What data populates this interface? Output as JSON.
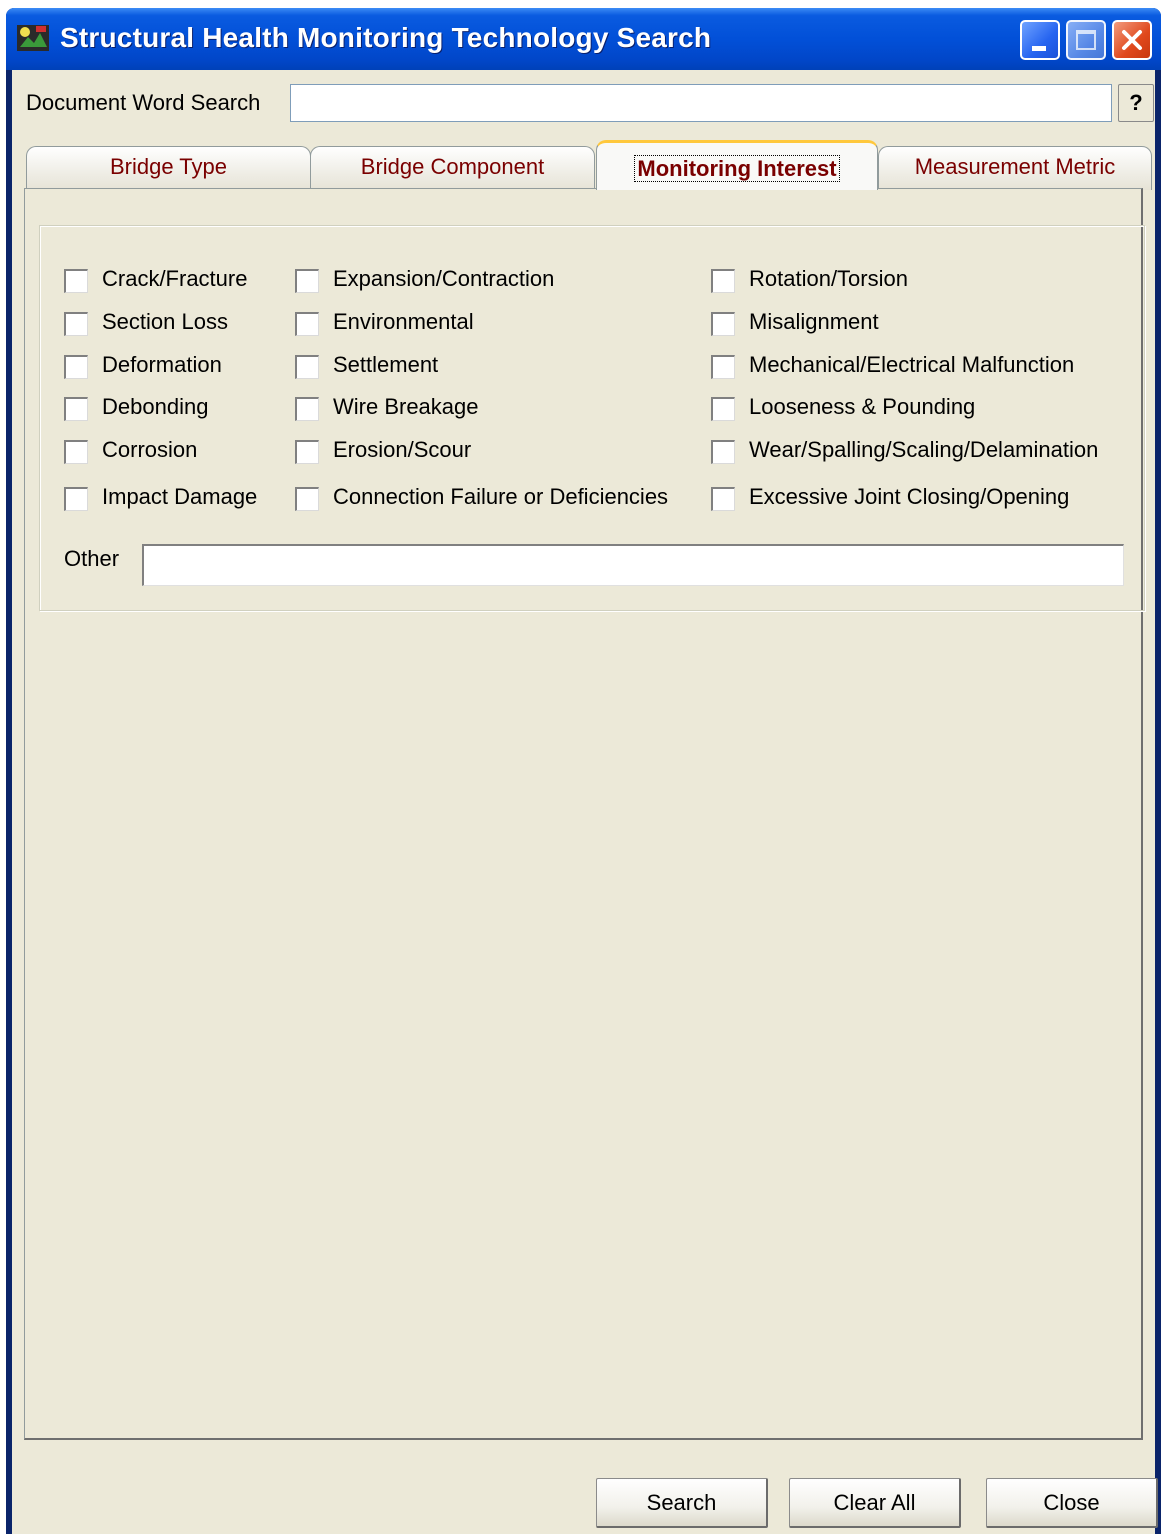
{
  "window": {
    "title": "Structural Health Monitoring Technology Search",
    "icon": "app-icon"
  },
  "search": {
    "label": "Document Word Search",
    "value": "",
    "help_label": "?"
  },
  "tabs": [
    {
      "label": "Bridge Type",
      "active": false
    },
    {
      "label": "Bridge Component",
      "active": false
    },
    {
      "label": "Monitoring Interest",
      "active": true
    },
    {
      "label": "Measurement Metric",
      "active": false
    }
  ],
  "monitoring_interest": {
    "col1": [
      "Crack/Fracture",
      "Section Loss",
      "Deformation",
      "Debonding",
      "Corrosion",
      "Impact Damage"
    ],
    "col2": [
      "Expansion/Contraction",
      "Environmental",
      "Settlement",
      "Wire Breakage",
      "Erosion/Scour",
      "Connection Failure or Deficiencies"
    ],
    "col3": [
      "Rotation/Torsion",
      "Misalignment",
      "Mechanical/Electrical Malfunction",
      "Looseness & Pounding",
      "Wear/Spalling/Scaling/Delamination",
      "Excessive Joint Closing/Opening"
    ],
    "other_label": "Other",
    "other_value": ""
  },
  "buttons": {
    "search": "Search",
    "clear_all": "Clear All",
    "close": "Close"
  },
  "colors": {
    "titlebar": "#0250D8",
    "tab_text": "#7A0000",
    "client_bg": "#ECE9D8"
  }
}
